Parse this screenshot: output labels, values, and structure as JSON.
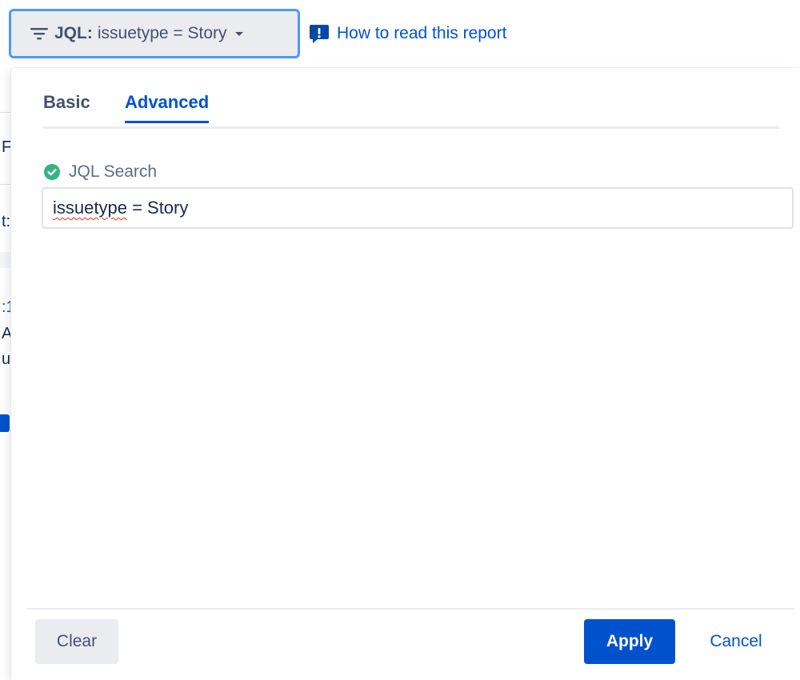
{
  "filter": {
    "label_bold": "JQL:",
    "label_value": "issuetype = Story"
  },
  "help": {
    "link_text": "How to read this report"
  },
  "background_fragments": [
    "F",
    "t:",
    ":1",
    "A",
    "u"
  ],
  "popup": {
    "tabs": [
      {
        "label": "Basic",
        "selected": false
      },
      {
        "label": "Advanced",
        "selected": true
      }
    ],
    "jql": {
      "label": "JQL Search",
      "status": "valid",
      "value_word": "issuetype",
      "value_rest": " = Story"
    },
    "footer": {
      "clear_label": "Clear",
      "apply_label": "Apply",
      "cancel_label": "Cancel"
    }
  },
  "colors": {
    "accent": "#0052cc",
    "focus_ring": "#4c9aff",
    "success": "#36b37e",
    "neutral_bg": "#ebecf0"
  },
  "icons": {
    "filter": "filter-lines-icon",
    "caret": "chevron-down-icon",
    "help": "feedback-icon",
    "status": "check-circle-icon"
  }
}
